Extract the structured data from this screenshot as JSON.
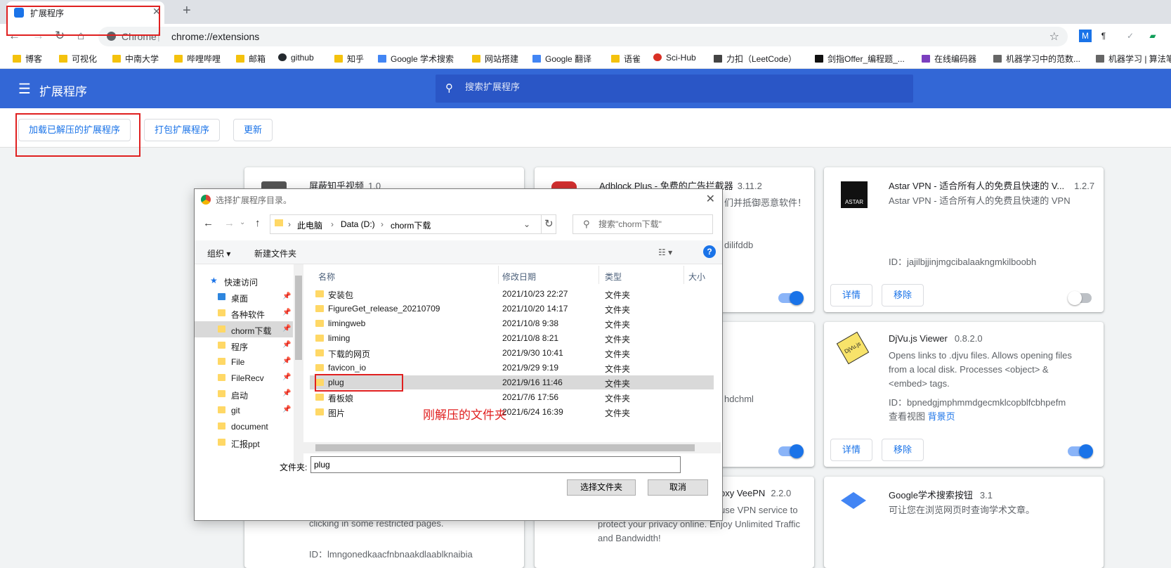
{
  "browser": {
    "tab_title": "扩展程序",
    "url_site": "Chrome",
    "url": "chrome://extensions",
    "bookmarks": [
      "博客",
      "可视化",
      "中南大学",
      "哔哩哔哩",
      "邮箱",
      "github",
      "知乎",
      "Google 学术搜索",
      "网站搭建",
      "Google 翻译",
      "语雀",
      "Sci-Hub",
      "力扣（LeetCode）",
      "剑指Offer_编程题_...",
      "在线编码器",
      "机器学习中的范数...",
      "机器学习 | 算法笔"
    ]
  },
  "extensions_page": {
    "title": "扩展程序",
    "search_placeholder": "搜索扩展程序",
    "load_unpacked": "加载已解压的扩展程序",
    "pack": "打包扩展程序",
    "update": "更新"
  },
  "cards": [
    {
      "name": "屏蔽知乎视频",
      "version": "1.0"
    },
    {
      "name": "Adblock Plus - 免费的广告拦截器",
      "version": "3.11.2",
      "desc_fragment": "们并抵御恶意软件！",
      "id_fragment": "dilifddb",
      "enabled": true
    },
    {
      "name": "Astar VPN - 适合所有人的免费且快速的 V...",
      "version": "1.2.7",
      "desc": "Astar VPN - 适合所有人的免费且快速的 VPN",
      "id": "ID：jajilbjjinjmgcibalaakngmkilboobh",
      "details": "详情",
      "remove": "移除",
      "enabled": false,
      "logo_text": "ASTAR"
    },
    {
      "id_fragment": "hdchml",
      "enabled": true
    },
    {
      "name": "DjVu.js Viewer",
      "version": "0.8.2.0",
      "desc": "Opens links to .djvu files. Allows opening files from a local disk. Processes <object> & <embed> tags.",
      "id": "ID：bpnedgjmphmmdgecmklcopblfcbhpefm",
      "views_label": "查看视图",
      "views_link": "背景页",
      "details": "详情",
      "remove": "移除",
      "enabled": true,
      "logo_text": "DjVu.js"
    },
    {
      "name_fragment": "oxy VeePN",
      "version": "2.2.0",
      "desc_fragment": "use VPN service to protect your privacy online. Enjoy Unlimited Traffic and Bandwidth!"
    },
    {
      "name": "Google学术搜索按钮",
      "version": "3.1",
      "desc": "可让您在浏览网页时查询学术文章。"
    },
    {
      "desc_fragment": "clicking in some restricted pages.",
      "id_fragment": "ID：lmngonedkaacfnbnaakdlaablknaibia"
    }
  ],
  "dialog": {
    "title": "选择扩展程序目录。",
    "path": [
      "此电脑",
      "Data (D:)",
      "chorm下载"
    ],
    "search_placeholder": "搜索\"chorm下载\"",
    "organize": "组织 ▾",
    "new_folder": "新建文件夹",
    "nav": [
      {
        "label": "快速访问",
        "pinned": false
      },
      {
        "label": "桌面",
        "pinned": true
      },
      {
        "label": "各种软件",
        "pinned": true
      },
      {
        "label": "chorm下载",
        "pinned": true
      },
      {
        "label": "程序",
        "pinned": true
      },
      {
        "label": "File",
        "pinned": true
      },
      {
        "label": "FileRecv",
        "pinned": true
      },
      {
        "label": "启动",
        "pinned": true
      },
      {
        "label": "git",
        "pinned": true
      },
      {
        "label": "document",
        "pinned": false
      },
      {
        "label": "汇报ppt",
        "pinned": false
      }
    ],
    "columns": {
      "name": "名称",
      "date": "修改日期",
      "type": "类型",
      "size": "大小"
    },
    "files": [
      {
        "name": "安装包",
        "date": "2021/10/23 22:27",
        "type": "文件夹"
      },
      {
        "name": "FigureGet_release_20210709",
        "date": "2021/10/20 14:17",
        "type": "文件夹"
      },
      {
        "name": "limingweb",
        "date": "2021/10/8 9:38",
        "type": "文件夹"
      },
      {
        "name": "liming",
        "date": "2021/10/8 8:21",
        "type": "文件夹"
      },
      {
        "name": "下载的网页",
        "date": "2021/9/30 10:41",
        "type": "文件夹"
      },
      {
        "name": "favicon_io",
        "date": "2021/9/29 9:19",
        "type": "文件夹"
      },
      {
        "name": "plug",
        "date": "2021/9/16 11:46",
        "type": "文件夹",
        "selected": true
      },
      {
        "name": "看板娘",
        "date": "2021/7/6 17:56",
        "type": "文件夹"
      },
      {
        "name": "图片",
        "date": "2021/6/24 16:39",
        "type": "文件夹"
      }
    ],
    "folder_label": "文件夹:",
    "folder_value": "plug",
    "select_button": "选择文件夹",
    "cancel_button": "取消"
  },
  "annotation": "刚解压的文件夹",
  "colors": {
    "header_blue": "#3367d6",
    "accent": "#1a73e8",
    "annotation_red": "#e02020"
  }
}
